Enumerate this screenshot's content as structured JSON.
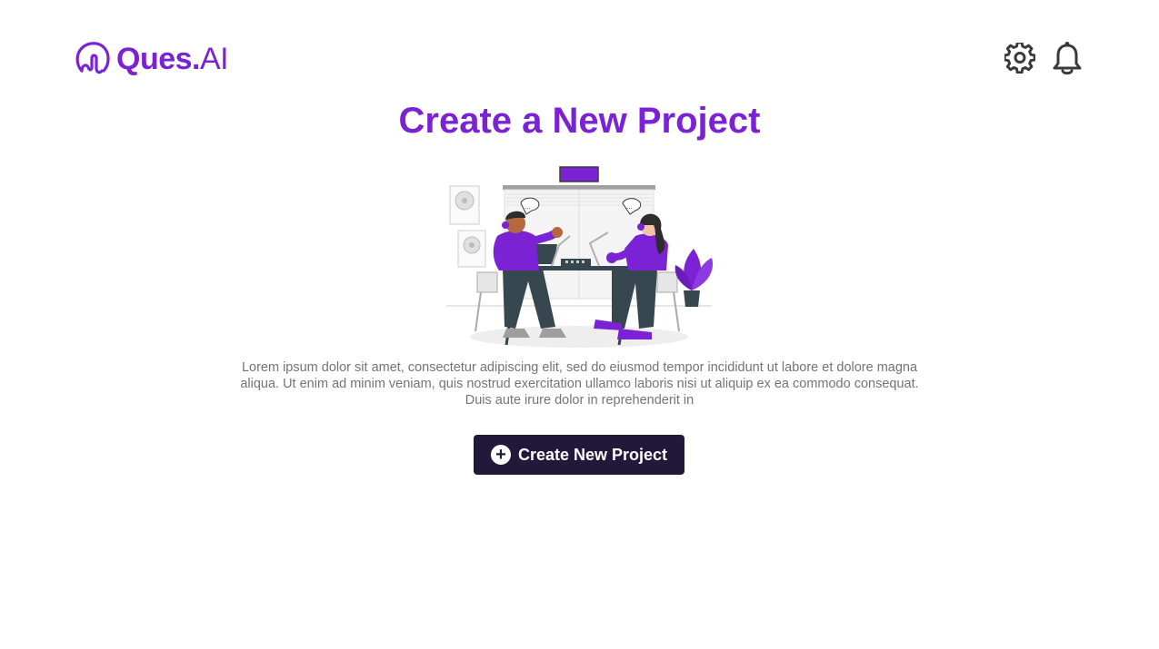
{
  "brand": {
    "name_bold": "Ques.",
    "name_light": "AI",
    "color": "#7b22d4"
  },
  "header": {
    "settings_icon": "gear-icon",
    "notifications_icon": "bell-icon"
  },
  "main": {
    "title": "Create a New Project",
    "illustration": "podcast-recording-illustration",
    "description": "Lorem ipsum dolor sit amet, consectetur adipiscing elit, sed do eiusmod tempor incididunt ut labore et dolore magna aliqua. Ut enim ad minim veniam, quis nostrud exercitation ullamco laboris nisi ut aliquip ex ea commodo consequat. Duis aute irure dolor in reprehenderit in",
    "create_button_label": "Create New Project",
    "create_button_icon": "plus-circle-icon",
    "button_color": "#22183a"
  }
}
